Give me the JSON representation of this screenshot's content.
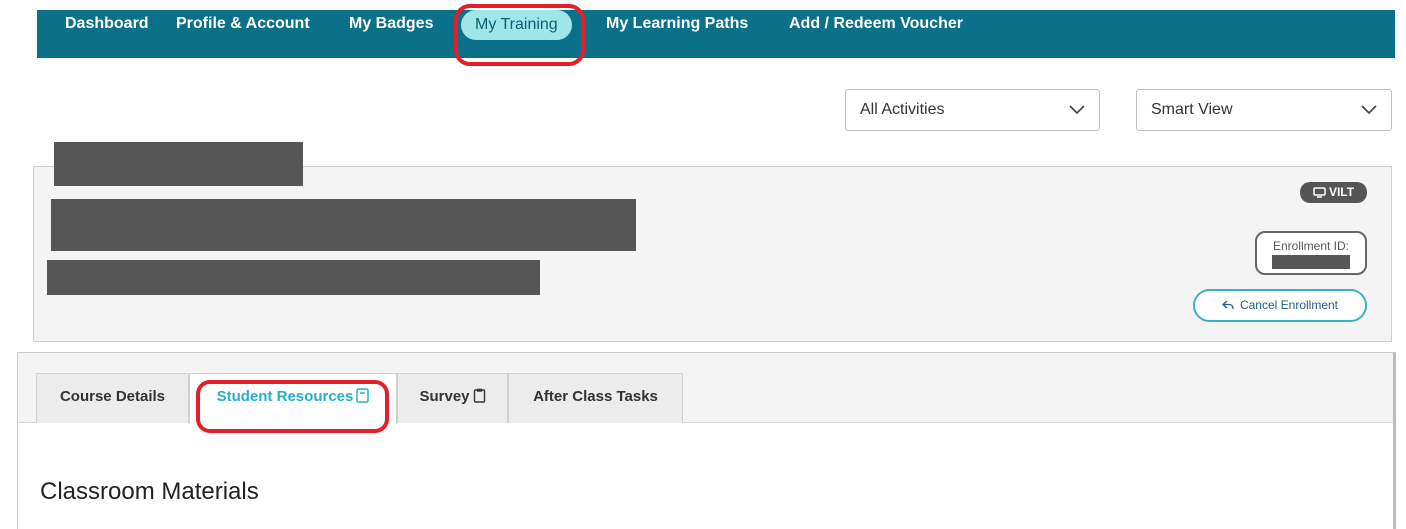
{
  "topnav": {
    "items": [
      {
        "label": "Dashboard"
      },
      {
        "label": "Profile & Account"
      },
      {
        "label": "My Badges"
      },
      {
        "label": "My Training"
      },
      {
        "label": "My Learning Paths"
      },
      {
        "label": "Add / Redeem Voucher"
      }
    ],
    "active_index": 3
  },
  "filters": {
    "activities": {
      "selected": "All Activities"
    },
    "view": {
      "selected": "Smart View"
    }
  },
  "course_card": {
    "badge": "VILT",
    "enrollment_label": "Enrollment ID:",
    "cancel_label": "Cancel Enrollment"
  },
  "tabs": [
    {
      "label": "Course Details"
    },
    {
      "label": "Student Resources"
    },
    {
      "label": "Survey"
    },
    {
      "label": "After Class Tasks"
    }
  ],
  "active_tab_index": 1,
  "content": {
    "section_title": "Classroom Materials"
  },
  "colors": {
    "nav_bg": "#0b7188",
    "nav_active_bg": "#9fe6e9",
    "highlight": "#e3202a",
    "accent": "#25b0c8"
  }
}
